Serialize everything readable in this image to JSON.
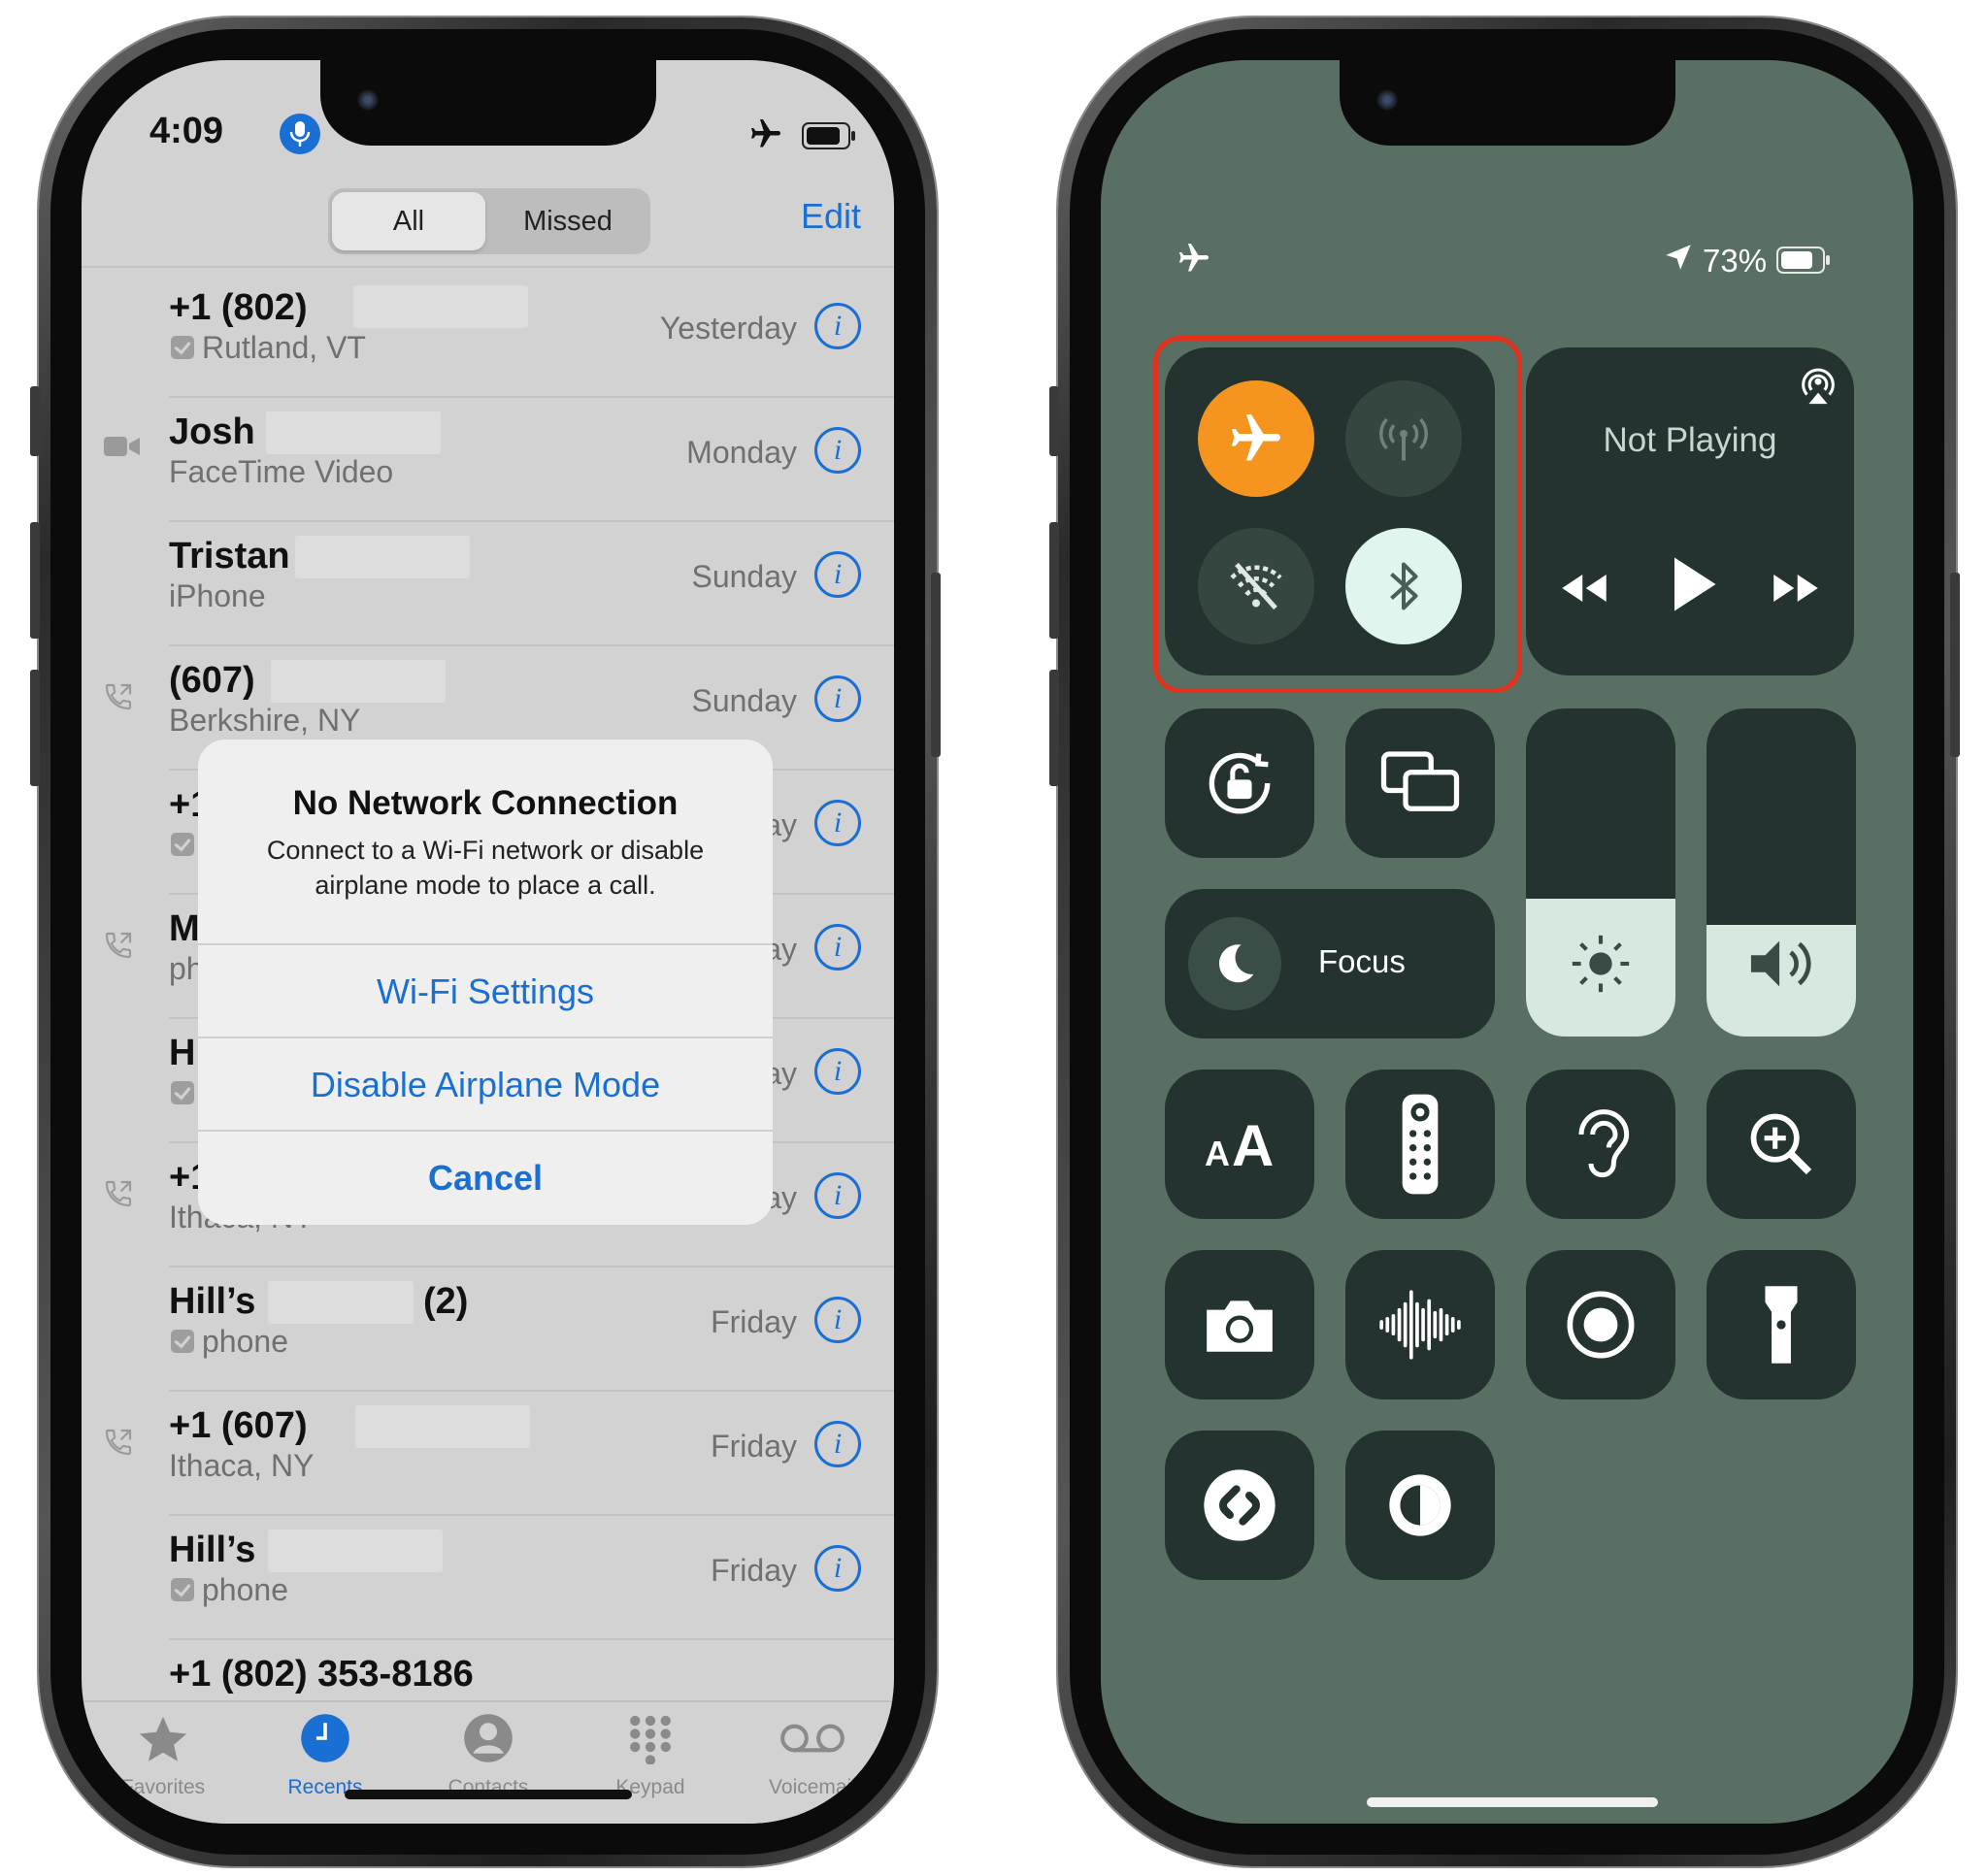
{
  "left_phone": {
    "status": {
      "time": "4:09",
      "airplane_icon": "airplane-icon",
      "battery_icon": "battery-icon"
    },
    "segmented": {
      "all": "All",
      "missed": "Missed"
    },
    "edit": "Edit",
    "calls": [
      {
        "name": "+1 (802)",
        "sub": "Rutland, VT",
        "when": "Yesterday",
        "checkbox": true,
        "lead": ""
      },
      {
        "name": "Josh",
        "sub": "FaceTime Video",
        "when": "Monday",
        "checkbox": false,
        "lead": "facetime-video-icon"
      },
      {
        "name": "Tristan",
        "sub": "iPhone",
        "when": "Sunday",
        "checkbox": false,
        "lead": ""
      },
      {
        "name": "(607)",
        "sub": "Berkshire, NY",
        "when": "Sunday",
        "checkbox": false,
        "lead": "outgoing-call-icon"
      },
      {
        "name": "+1",
        "sub": "",
        "when": "ay",
        "checkbox": true,
        "lead": ""
      },
      {
        "name": "Mi",
        "sub": "ph",
        "when": "ay",
        "checkbox": false,
        "lead": "outgoing-call-icon"
      },
      {
        "name": "Hi",
        "sub": "",
        "when": "ay",
        "checkbox": true,
        "lead": ""
      },
      {
        "name": "+1",
        "sub": "Ithaca, NY",
        "when": "ay",
        "checkbox": false,
        "lead": "outgoing-call-icon"
      },
      {
        "name": "Hill’s",
        "name_suffix": "(2)",
        "sub": "phone",
        "when": "Friday",
        "checkbox": true,
        "lead": ""
      },
      {
        "name": "+1 (607)",
        "sub": "Ithaca, NY",
        "when": "Friday",
        "checkbox": false,
        "lead": "outgoing-call-icon"
      },
      {
        "name": "Hill’s",
        "sub": "phone",
        "when": "Friday",
        "checkbox": true,
        "lead": ""
      },
      {
        "name": "+1 (802) 353-8186",
        "sub": "",
        "when": "",
        "checkbox": false,
        "lead": ""
      }
    ],
    "alert": {
      "title": "No Network Connection",
      "message": "Connect to a Wi-Fi network or disable airplane mode to place a call.",
      "wifi_settings": "Wi-Fi Settings",
      "disable_airplane": "Disable Airplane Mode",
      "cancel": "Cancel"
    },
    "tabs": [
      {
        "label": "Favorites",
        "icon": "star-icon",
        "active": false
      },
      {
        "label": "Recents",
        "icon": "clock-icon",
        "active": true
      },
      {
        "label": "Contacts",
        "icon": "person-icon",
        "active": false
      },
      {
        "label": "Keypad",
        "icon": "keypad-icon",
        "active": false
      },
      {
        "label": "Voicemail",
        "icon": "voicemail-icon",
        "active": false
      }
    ]
  },
  "right_phone": {
    "status": {
      "battery_percent": "73%",
      "airplane_icon": "airplane-icon",
      "location_icon": "location-arrow-icon"
    },
    "connectivity": {
      "airplane_mode": {
        "icon": "airplane-icon",
        "on": true
      },
      "cellular": {
        "icon": "cellular-antenna-icon",
        "on": false
      },
      "wifi": {
        "icon": "wifi-off-icon",
        "on": false
      },
      "bluetooth": {
        "icon": "bluetooth-icon",
        "on": true
      }
    },
    "media": {
      "status": "Not Playing",
      "airplay_icon": "airplay-icon"
    },
    "focus": {
      "label": "Focus",
      "icon": "moon-icon"
    },
    "brightness_level": 0.42,
    "volume_level": 0.34,
    "colors": {
      "airplane_active": "#f5941f",
      "bluetooth_active": "#dff5ee",
      "highlight": "#e0321c",
      "ios_blue": "#1a6fd4"
    }
  }
}
